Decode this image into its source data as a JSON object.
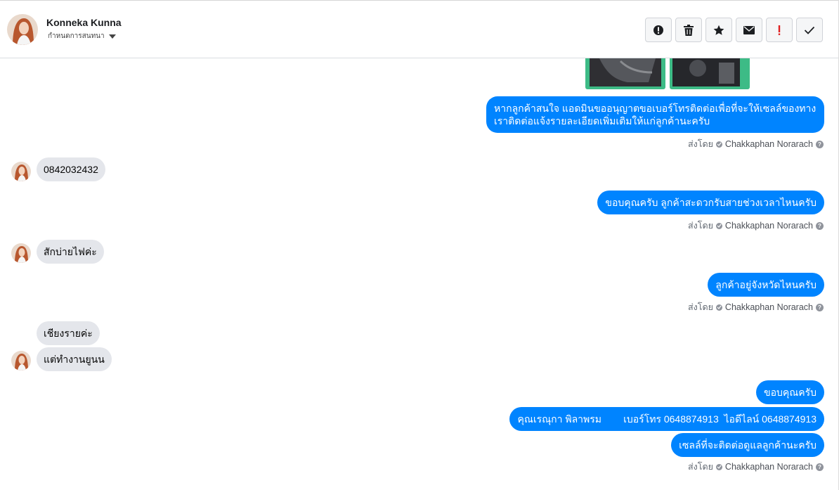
{
  "contact": {
    "name": "Konneka Kunna",
    "assign_label": "กำหนดการสนทนา"
  },
  "toolbar": {
    "buttons": [
      {
        "name": "spam-icon",
        "label": "!"
      },
      {
        "name": "trash-icon",
        "label": "delete"
      },
      {
        "name": "star-icon",
        "label": "star"
      },
      {
        "name": "mail-icon",
        "label": "mail"
      },
      {
        "name": "important-icon",
        "label": "!"
      },
      {
        "name": "check-icon",
        "label": "done"
      }
    ],
    "important_color": "#e02020",
    "spam_color": "#1c1e21"
  },
  "messages": {
    "out1": "หากลูกค้าสนใจ แอดมินขออนุญาตขอเบอร์โทรติดต่อเพื่อที่จะให้เซลล์ของทางเราติดต่อแจ้งรายละเอียดเพิ่มเติมให้แก่ลูกค้านะครับ",
    "in1": "0842032432",
    "out2": "ขอบคุณครับ ลูกค้าสะดวกรับสายช่วงเวลาไหนครับ",
    "in2": "สักบ่ายไฟค่ะ",
    "out3": "ลูกค้าอยู่จังหวัดไหนครับ",
    "in3": "เชียงรายค่ะ",
    "in4": "แต่ทำงานยูนน",
    "out4": "ขอบคุณครับ",
    "out5": "คุณเรณุกา พิลาพรม        เบอร์โทร 0648874913  ไอดีไลน์ 0648874913",
    "out6": "เซลล์ที่จะติดต่อดูแลลูกค้านะครับ"
  },
  "sent_by": {
    "prefix": "ส่งโดย",
    "agent": "Chakkaphan Norarach",
    "help": "?"
  },
  "colors": {
    "outgoing_bubble": "#0084ff",
    "incoming_bubble": "#e4e6eb"
  }
}
